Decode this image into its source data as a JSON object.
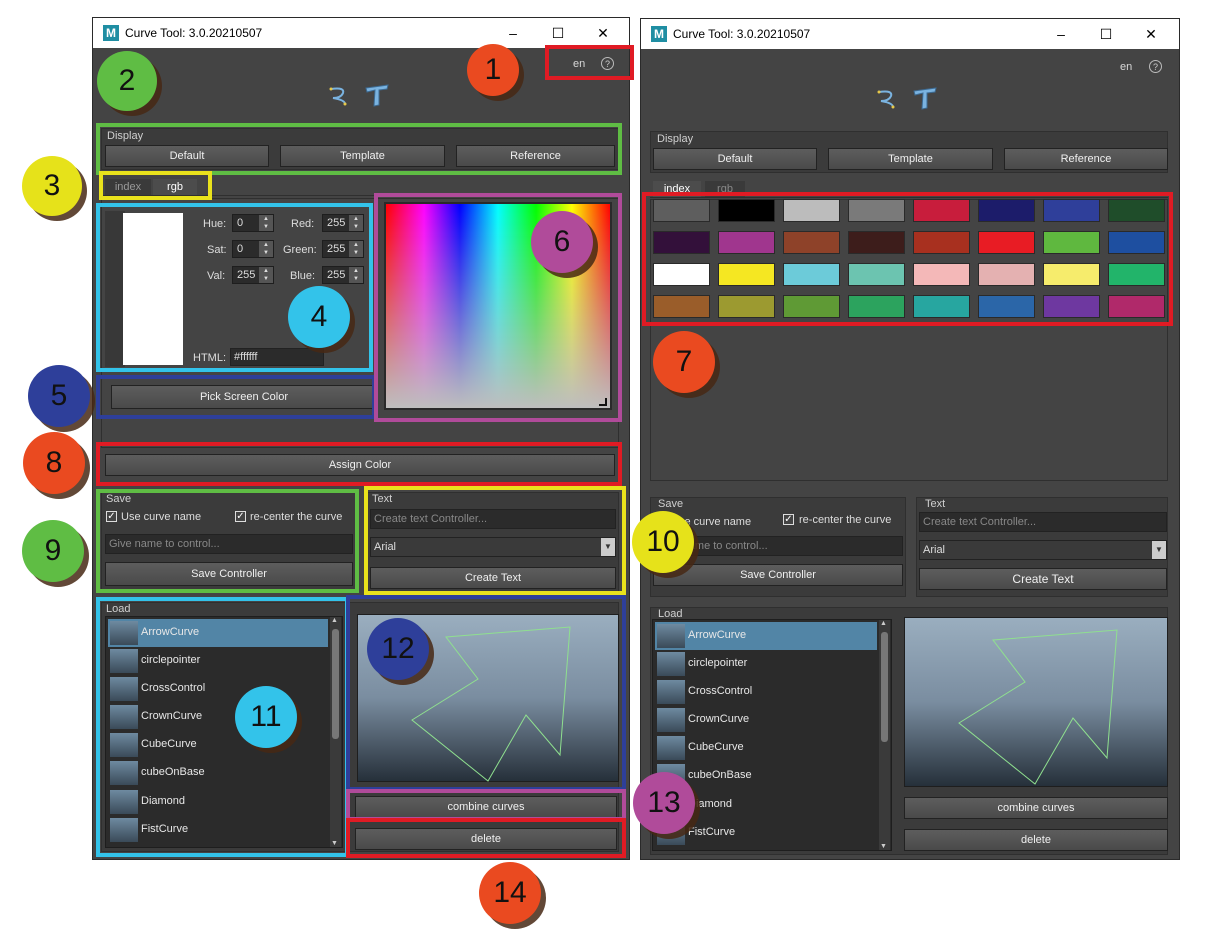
{
  "app": {
    "title": "Curve Tool: 3.0.20210507",
    "icon_letter": "M",
    "window_buttons": [
      "–",
      "☐",
      "✕"
    ],
    "language": "en",
    "help_glyph": "?",
    "tool_icons": [
      "curve-icon",
      "text-icon"
    ]
  },
  "display": {
    "label": "Display",
    "buttons": [
      "Default",
      "Template",
      "Reference"
    ]
  },
  "color_tabs": [
    "index",
    "rgb"
  ],
  "rgb_panel": {
    "hue_label": "Hue:",
    "hue": "0",
    "sat_label": "Sat:",
    "sat": "0",
    "val_label": "Val:",
    "val": "255",
    "red_label": "Red:",
    "red": "255",
    "green_label": "Green:",
    "green": "255",
    "blue_label": "Blue:",
    "blue": "255",
    "html_label": "HTML:",
    "html": "#ffffff",
    "current_color": "#ffffff"
  },
  "pick_screen_color": "Pick Screen Color",
  "assign_color": "Assign Color",
  "index_colors": [
    "#5e5e5e",
    "#000000",
    "#bcbcbc",
    "#7a7a7a",
    "#c81d3c",
    "#1c1c6a",
    "#2f3f9a",
    "#1f4d2a",
    "#33103a",
    "#a0368e",
    "#8e4229",
    "#3d1d1b",
    "#a8301f",
    "#e81c24",
    "#5fb83f",
    "#1e4fa0",
    "#ffffff",
    "#f5e722",
    "#6ccbd9",
    "#6cc4b0",
    "#f4b8b8",
    "#e4b1b1",
    "#f6ec6c",
    "#22b46a",
    "#9a5d2a",
    "#9c9a30",
    "#5f9a35",
    "#2ca35e",
    "#27a6a0",
    "#2b66a8",
    "#6e38a0",
    "#b0296a"
  ],
  "save": {
    "label": "Save",
    "use_curve_name": "Use curve name",
    "recenter": "re-center the curve",
    "name_placeholder": "Give name to control...",
    "save_button": "Save Controller"
  },
  "text": {
    "label": "Text",
    "placeholder": "Create text Controller...",
    "font": "Arial",
    "create_button": "Create Text"
  },
  "load": {
    "label": "Load",
    "items": [
      "ArrowCurve",
      "circlepointer",
      "CrossControl",
      "CrownCurve",
      "CubeCurve",
      "cubeOnBase",
      "Diamond",
      "FistCurve"
    ],
    "selected": "ArrowCurve"
  },
  "actions": {
    "combine": "combine curves",
    "delete": "delete"
  },
  "markers": [
    "1",
    "2",
    "3",
    "4",
    "5",
    "6",
    "7",
    "8",
    "9",
    "10",
    "11",
    "12",
    "13",
    "14"
  ]
}
